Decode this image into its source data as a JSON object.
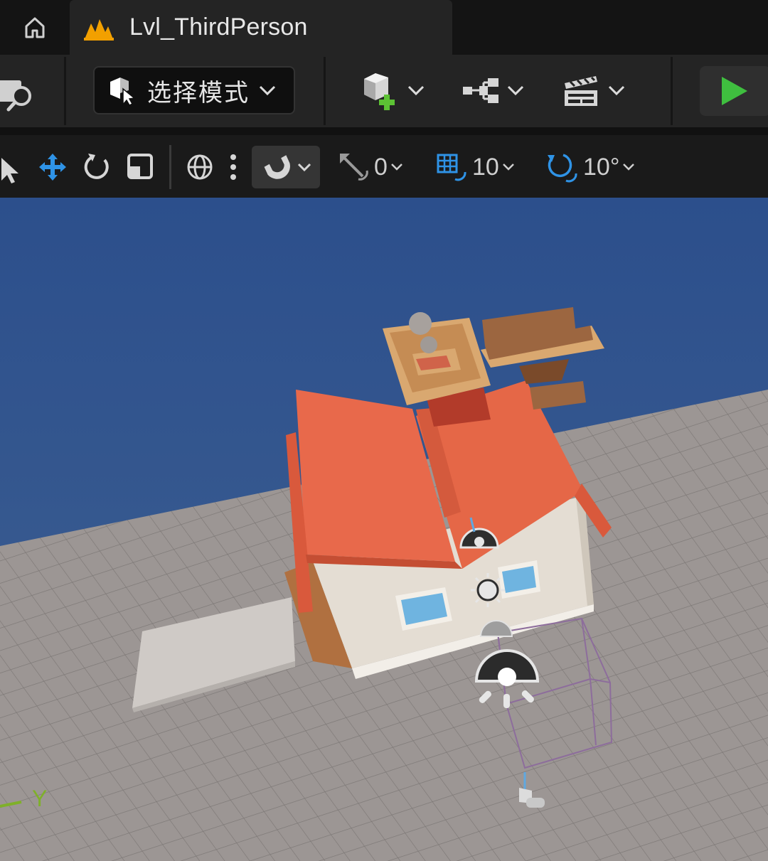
{
  "tabs": {
    "home_icon": "home-icon",
    "level": {
      "icon": "level-icon",
      "title": "Lvl_ThirdPerson"
    }
  },
  "toolbar": {
    "content_browser_icon": "content-browser-icon",
    "mode": {
      "icon": "select-mode-icon",
      "label": "选择模式"
    },
    "add_actor_icon": "add-actor-icon",
    "blueprint_icon": "blueprint-icon",
    "cinematics_icon": "cinematics-icon",
    "play_icon": "play-icon",
    "play_color": "#3fbf3f"
  },
  "viewport_toolbar": {
    "tools": [
      "select-icon",
      "translate-icon",
      "rotate-icon",
      "scale-icon"
    ],
    "coordinate_icon": "world-space-icon",
    "surface_snap_icon": "surface-snap-icon",
    "scale_snap": {
      "icon": "scale-snap-icon",
      "value": "0"
    },
    "grid_snap": {
      "icon": "grid-snap-icon",
      "value": "10"
    },
    "rotation_snap": {
      "icon": "rotation-snap-icon",
      "value": "10°"
    },
    "accent_color": "#2f93e6"
  },
  "viewport": {
    "sky_color": "#2f5592",
    "floor_color": "#9b9593",
    "axis_label": "Y",
    "axis_color": "#7fb02a"
  }
}
